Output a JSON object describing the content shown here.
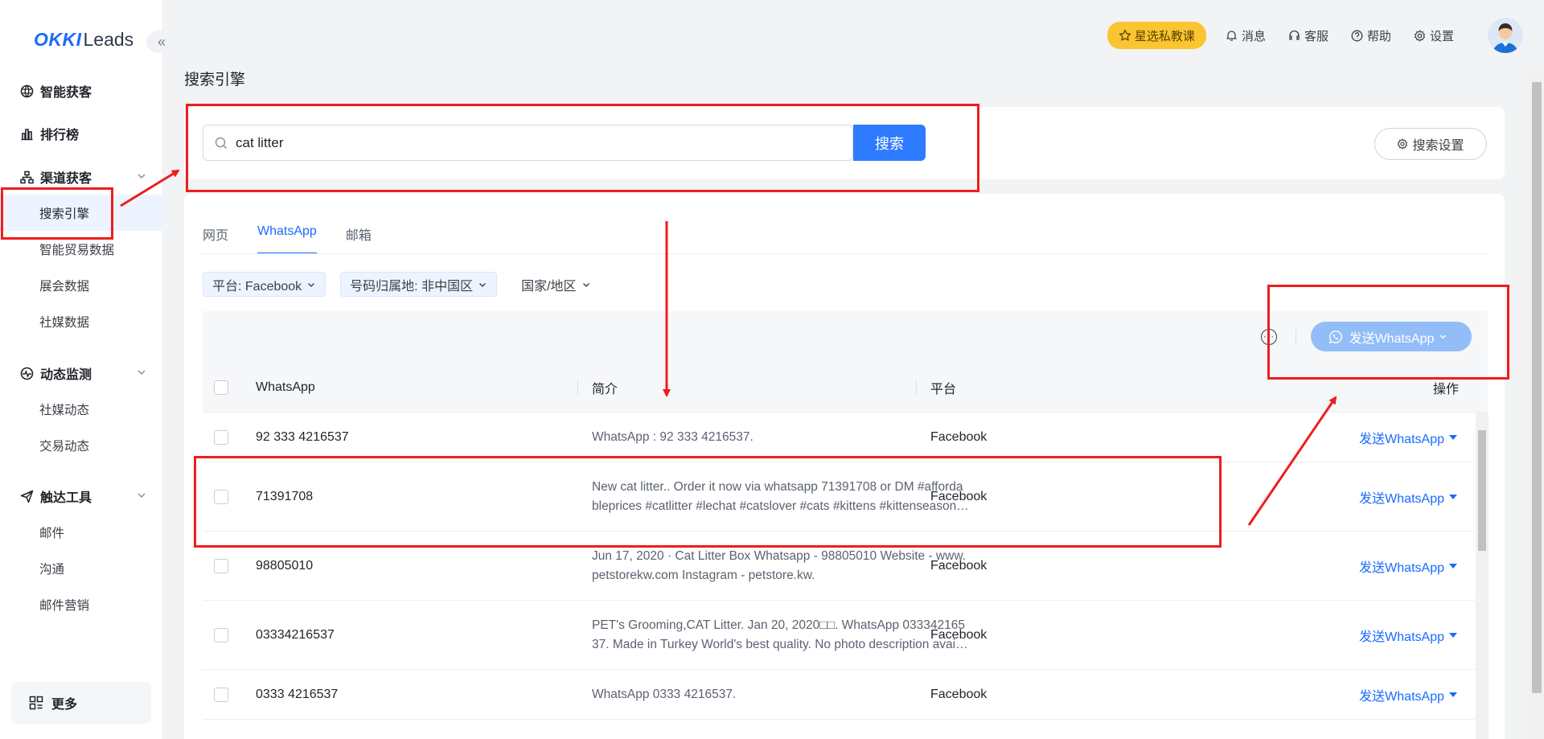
{
  "brand": {
    "logo_main": "OKKI",
    "logo_sub": "Leads",
    "collapse_glyph": "«"
  },
  "sidebar": {
    "groups": [
      {
        "label": "智能获客",
        "icon": "globe-icon",
        "items": []
      },
      {
        "label": "排行榜",
        "icon": "bar-chart-icon",
        "items": []
      },
      {
        "label": "渠道获客",
        "icon": "network-icon",
        "items": [
          "搜索引擎",
          "智能贸易数据",
          "展会数据",
          "社媒数据"
        ],
        "active_item": "搜索引擎"
      },
      {
        "label": "动态监测",
        "icon": "pulse-icon",
        "items": [
          "社媒动态",
          "交易动态"
        ]
      },
      {
        "label": "触达工具",
        "icon": "send-icon",
        "items": [
          "邮件",
          "沟通",
          "邮件营销"
        ]
      }
    ],
    "more_label": "更多"
  },
  "header": {
    "promo_label": "星选私教课",
    "links": [
      {
        "label": "消息",
        "icon": "bell-icon"
      },
      {
        "label": "客服",
        "icon": "headset-icon"
      },
      {
        "label": "帮助",
        "icon": "help-icon"
      },
      {
        "label": "设置",
        "icon": "gear-icon"
      }
    ]
  },
  "page_title": "搜索引擎",
  "search": {
    "value": "cat litter",
    "button_label": "搜索",
    "settings_label": "搜索设置"
  },
  "tabs": {
    "items": [
      "网页",
      "WhatsApp",
      "邮箱"
    ],
    "active": "WhatsApp"
  },
  "filters": {
    "platform": "平台: Facebook",
    "region": "号码归属地: 非中国区",
    "country": "国家/地区"
  },
  "toolbar": {
    "more_glyph": "···",
    "send_label": "发送WhatsApp"
  },
  "table": {
    "columns": {
      "whatsapp": "WhatsApp",
      "desc": "简介",
      "platform": "平台",
      "action": "操作"
    },
    "rows": [
      {
        "number": "92 333 4216537",
        "desc1": "WhatsApp : 92 333 4216537.",
        "desc2": "",
        "platform": "Facebook",
        "action": "发送WhatsApp"
      },
      {
        "number": "71391708",
        "desc1": "New cat litter.. Order it now via whatsapp 71391708 or DM #afforda",
        "desc2": "bleprices #catlitter #lechat #catslover #cats #kittens #kittenseason…",
        "platform": "Facebook",
        "action": "发送WhatsApp"
      },
      {
        "number": "98805010",
        "desc1": "Jun 17, 2020 · Cat Litter Box Whatsapp - 98805010 Website - www.",
        "desc2": "petstorekw.com Instagram - petstore.kw.",
        "platform": "Facebook",
        "action": "发送WhatsApp"
      },
      {
        "number": "03334216537",
        "desc1": "PET's Grooming,CAT Litter. Jan 20, 2020□□. WhatsApp 033342165",
        "desc2": "37. Made in Turkey World's best quality. No photo description avai…",
        "platform": "Facebook",
        "action": "发送WhatsApp"
      },
      {
        "number": "0333 4216537",
        "desc1": "WhatsApp 0333 4216537.",
        "desc2": "",
        "platform": "Facebook",
        "action": "发送WhatsApp"
      }
    ]
  },
  "colors": {
    "accent": "#1a6bff",
    "annotation": "#ee1d1d",
    "promo": "#fbc531"
  }
}
